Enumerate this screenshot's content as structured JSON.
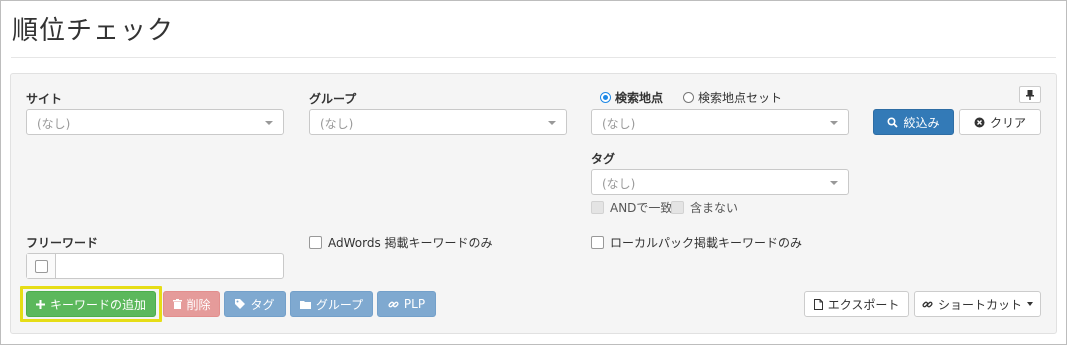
{
  "page": {
    "title": "順位チェック"
  },
  "filters": {
    "site": {
      "label": "サイト",
      "value": "(なし)"
    },
    "group": {
      "label": "グループ",
      "value": "(なし)"
    },
    "location": {
      "radio_point": "検索地点",
      "radio_set": "検索地点セット",
      "selected": "検索地点",
      "value": "(なし)"
    },
    "tag": {
      "label": "タグ",
      "value": "(なし)",
      "and_match": "ANDで一致",
      "exclude": "含まない"
    },
    "freeword": {
      "label": "フリーワード",
      "value": ""
    },
    "adwords_only": "AdWords 掲載キーワードのみ",
    "localpack_only": "ローカルパック掲載キーワードのみ"
  },
  "buttons": {
    "filter": "絞込み",
    "clear": "クリア",
    "add_keyword": "キーワードの追加",
    "delete": "削除",
    "tag": "タグ",
    "group": "グループ",
    "plp": "PLP",
    "export": "エクスポート",
    "shortcut": "ショートカット"
  },
  "colors": {
    "primary": "#337ab7",
    "success": "#5cb85c",
    "danger_disabled": "#e59b9a",
    "info_disabled": "#7fa9d0",
    "highlight": "#e6dd16"
  }
}
